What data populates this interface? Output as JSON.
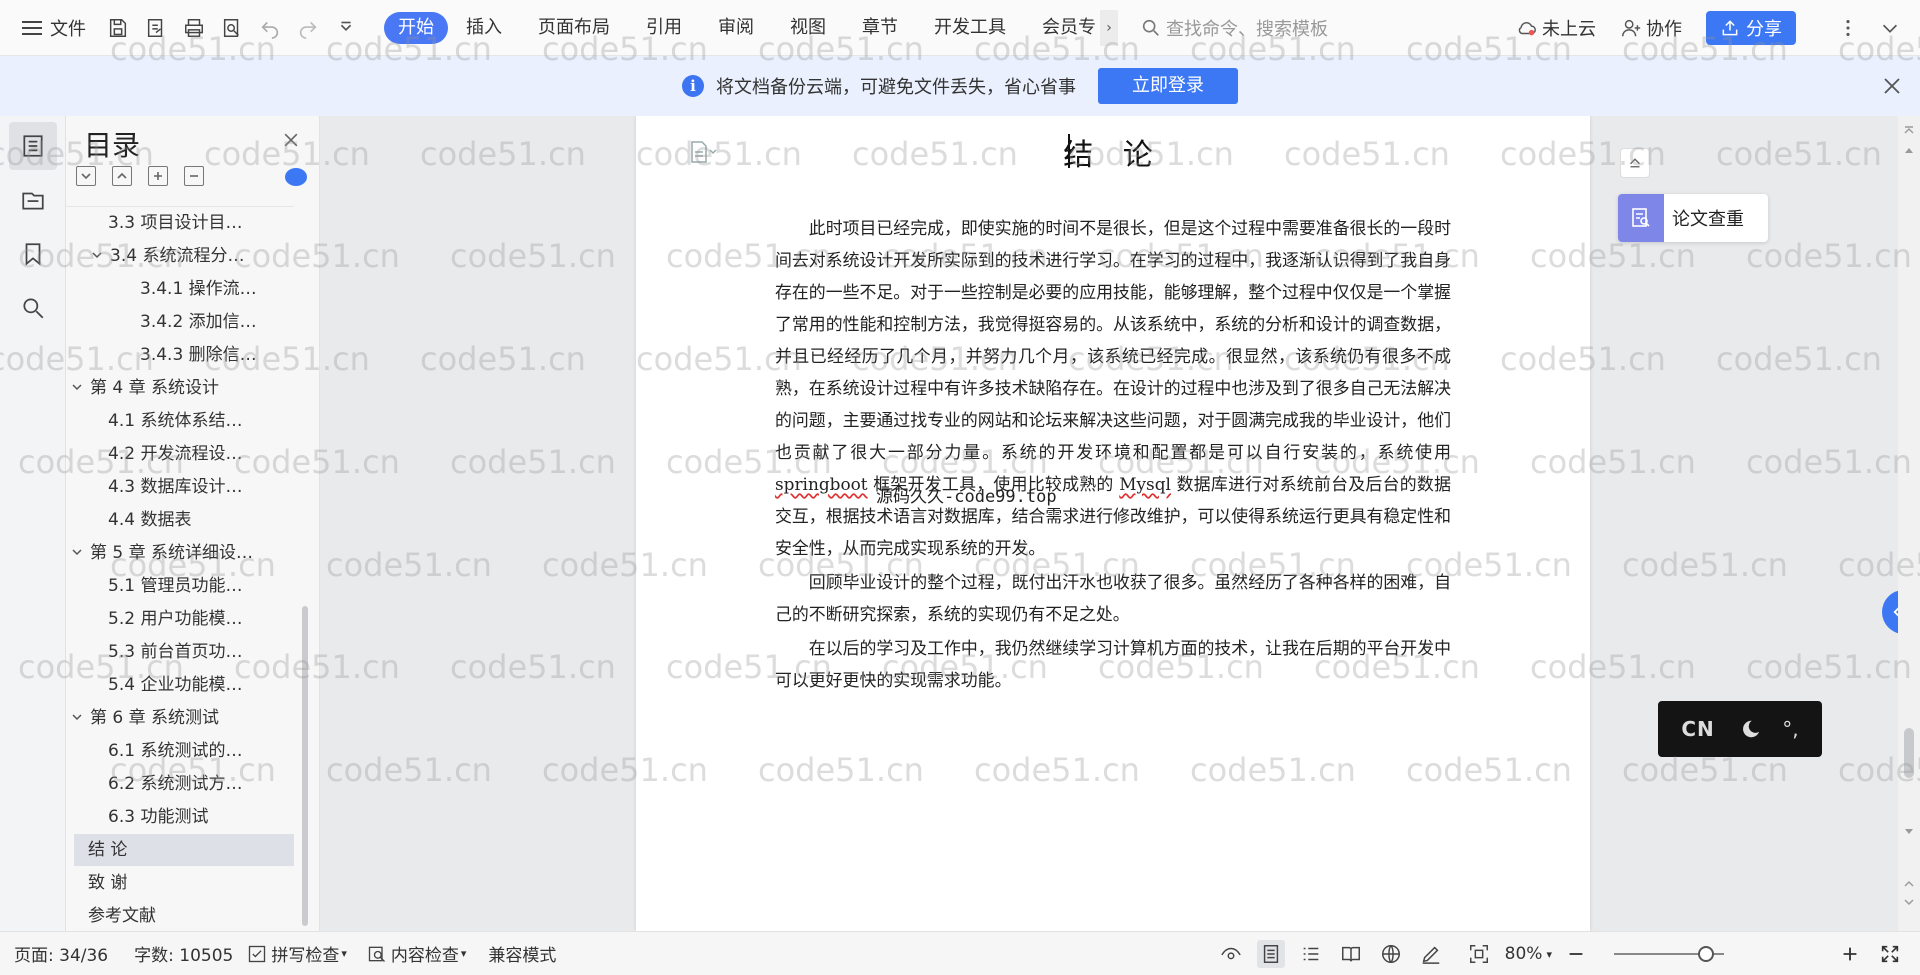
{
  "topbar": {
    "file_label": "文件",
    "tabs": [
      {
        "label": "开始",
        "active": true
      },
      {
        "label": "插入"
      },
      {
        "label": "页面布局"
      },
      {
        "label": "引用"
      },
      {
        "label": "审阅"
      },
      {
        "label": "视图"
      },
      {
        "label": "章节"
      },
      {
        "label": "开发工具"
      },
      {
        "label": "会员专"
      }
    ],
    "search_placeholder": "查找命令、搜索模板",
    "cloud_label": "未上云",
    "collab_label": "协作",
    "share_label": "分享",
    "accent": "#3c78f4"
  },
  "notice": {
    "message": "将文档备份云端，可避免文件丢失，省心省事",
    "login_label": "立即登录"
  },
  "toc": {
    "title": "目录",
    "items": [
      {
        "label": "3.3 项目设计目…",
        "level": 2,
        "caret": false
      },
      {
        "label": "3.4 系统流程分…",
        "level": 2,
        "caret": true
      },
      {
        "label": "3.4.1 操作流…",
        "level": 3,
        "caret": false
      },
      {
        "label": "3.4.2 添加信…",
        "level": 3,
        "caret": false
      },
      {
        "label": "3.4.3 删除信…",
        "level": 3,
        "caret": false
      },
      {
        "label": "第 4 章  系统设计",
        "level": 1,
        "caret": true
      },
      {
        "label": "4.1  系统体系结…",
        "level": 2,
        "caret": false
      },
      {
        "label": "4.2 开发流程设…",
        "level": 2,
        "caret": false
      },
      {
        "label": "4.3  数据库设计…",
        "level": 2,
        "caret": false
      },
      {
        "label": "4.4  数据表",
        "level": 2,
        "caret": false
      },
      {
        "label": "第 5 章  系统详细设…",
        "level": 1,
        "caret": true
      },
      {
        "label": "5.1 管理员功能…",
        "level": 2,
        "caret": false
      },
      {
        "label": "5.2 用户功能模…",
        "level": 2,
        "caret": false
      },
      {
        "label": "5.3 前台首页功…",
        "level": 2,
        "caret": false
      },
      {
        "label": "5.4 企业功能模…",
        "level": 2,
        "caret": false
      },
      {
        "label": "第 6 章    系统测试",
        "level": 1,
        "caret": true
      },
      {
        "label": "6.1 系统测试的…",
        "level": 2,
        "caret": false
      },
      {
        "label": "6.2 系统测试方…",
        "level": 2,
        "caret": false
      },
      {
        "label": "6.3 功能测试",
        "level": 2,
        "caret": false
      },
      {
        "label": "结    论",
        "level": 1,
        "caret": false,
        "selected": true
      },
      {
        "label": "致    谢",
        "level": 1,
        "caret": false
      },
      {
        "label": "参考文献",
        "level": 1,
        "caret": false
      }
    ]
  },
  "document": {
    "title": "结  论",
    "p1_a": "此时项目已经完成，即使实施的时间不是很长，但是这个过程中需要准备很长的一段时间去对系统设计开发所实际到的技术进行学习。在学习的过程中，我逐渐认识得到了我自身存在的一些不足。对于一些控制是必要的应用技能，能够理解，整个过程中仅仅是一个掌握了常用的性能和控制方法，我觉得挺容易的。从该系统中，系统的分析和设计的调查数据，并且已经经历了几个月，并努力几个月，该系统已经完成。很显然，该系统仍有很多不成熟，在系统设计过程中有许多技术缺陷存在。在设计的过程中也涉及到了很多自己无法解决的问题，主要通过找专业的网站和论坛来解决这些问题，对于圆满完成我的毕业设计，他们也贡献了很大一部分力量。系统的开发环境和配置都是可以自行安装的，系统使用",
    "p1_word1": "springboot",
    "p1_b": " 框架开发工具，使用比较成熟的 ",
    "p1_word2": "Mysql",
    "p1_c": " 数据库进行对系统前台及后台的数据交互，根据技术语言对数据库，结合需求进行修改维护，可以使得系统运行更具有稳定性和安全性，从而完成实现系统的开发。",
    "p2": "回顾毕业设计的整个过程，既付出汗水也收获了很多。虽然经历了各种各样的困难，自己的不断研究探索，系统的实现仍有不足之处。",
    "p3": "在以后的学习及工作中，我仍然继续学习计算机方面的技术，让我在后期的平台开发中可以更好更快的实现需求功能。",
    "overlay_text": "源码久久-code99.top"
  },
  "side": {
    "lunwen_label": "论文查重",
    "ime_cn": "CN",
    "ime_punct": "°,"
  },
  "status": {
    "page": "页面: 34/36",
    "words": "字数: 10505",
    "spell": "拼写检查",
    "content_check": "内容检查",
    "compat": "兼容模式",
    "zoom": "80%",
    "zoom_fraction": 0.8
  },
  "watermark": "code51.cn"
}
